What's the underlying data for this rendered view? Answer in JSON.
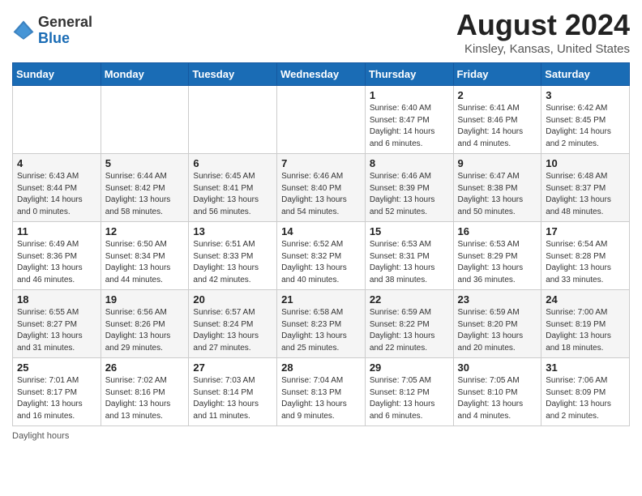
{
  "header": {
    "logo_general": "General",
    "logo_blue": "Blue",
    "main_title": "August 2024",
    "subtitle": "Kinsley, Kansas, United States"
  },
  "columns": [
    "Sunday",
    "Monday",
    "Tuesday",
    "Wednesday",
    "Thursday",
    "Friday",
    "Saturday"
  ],
  "footer": {
    "note": "Daylight hours"
  },
  "weeks": [
    [
      {
        "day": "",
        "info": ""
      },
      {
        "day": "",
        "info": ""
      },
      {
        "day": "",
        "info": ""
      },
      {
        "day": "",
        "info": ""
      },
      {
        "day": "1",
        "info": "Sunrise: 6:40 AM\nSunset: 8:47 PM\nDaylight: 14 hours\nand 6 minutes."
      },
      {
        "day": "2",
        "info": "Sunrise: 6:41 AM\nSunset: 8:46 PM\nDaylight: 14 hours\nand 4 minutes."
      },
      {
        "day": "3",
        "info": "Sunrise: 6:42 AM\nSunset: 8:45 PM\nDaylight: 14 hours\nand 2 minutes."
      }
    ],
    [
      {
        "day": "4",
        "info": "Sunrise: 6:43 AM\nSunset: 8:44 PM\nDaylight: 14 hours\nand 0 minutes."
      },
      {
        "day": "5",
        "info": "Sunrise: 6:44 AM\nSunset: 8:42 PM\nDaylight: 13 hours\nand 58 minutes."
      },
      {
        "day": "6",
        "info": "Sunrise: 6:45 AM\nSunset: 8:41 PM\nDaylight: 13 hours\nand 56 minutes."
      },
      {
        "day": "7",
        "info": "Sunrise: 6:46 AM\nSunset: 8:40 PM\nDaylight: 13 hours\nand 54 minutes."
      },
      {
        "day": "8",
        "info": "Sunrise: 6:46 AM\nSunset: 8:39 PM\nDaylight: 13 hours\nand 52 minutes."
      },
      {
        "day": "9",
        "info": "Sunrise: 6:47 AM\nSunset: 8:38 PM\nDaylight: 13 hours\nand 50 minutes."
      },
      {
        "day": "10",
        "info": "Sunrise: 6:48 AM\nSunset: 8:37 PM\nDaylight: 13 hours\nand 48 minutes."
      }
    ],
    [
      {
        "day": "11",
        "info": "Sunrise: 6:49 AM\nSunset: 8:36 PM\nDaylight: 13 hours\nand 46 minutes."
      },
      {
        "day": "12",
        "info": "Sunrise: 6:50 AM\nSunset: 8:34 PM\nDaylight: 13 hours\nand 44 minutes."
      },
      {
        "day": "13",
        "info": "Sunrise: 6:51 AM\nSunset: 8:33 PM\nDaylight: 13 hours\nand 42 minutes."
      },
      {
        "day": "14",
        "info": "Sunrise: 6:52 AM\nSunset: 8:32 PM\nDaylight: 13 hours\nand 40 minutes."
      },
      {
        "day": "15",
        "info": "Sunrise: 6:53 AM\nSunset: 8:31 PM\nDaylight: 13 hours\nand 38 minutes."
      },
      {
        "day": "16",
        "info": "Sunrise: 6:53 AM\nSunset: 8:29 PM\nDaylight: 13 hours\nand 36 minutes."
      },
      {
        "day": "17",
        "info": "Sunrise: 6:54 AM\nSunset: 8:28 PM\nDaylight: 13 hours\nand 33 minutes."
      }
    ],
    [
      {
        "day": "18",
        "info": "Sunrise: 6:55 AM\nSunset: 8:27 PM\nDaylight: 13 hours\nand 31 minutes."
      },
      {
        "day": "19",
        "info": "Sunrise: 6:56 AM\nSunset: 8:26 PM\nDaylight: 13 hours\nand 29 minutes."
      },
      {
        "day": "20",
        "info": "Sunrise: 6:57 AM\nSunset: 8:24 PM\nDaylight: 13 hours\nand 27 minutes."
      },
      {
        "day": "21",
        "info": "Sunrise: 6:58 AM\nSunset: 8:23 PM\nDaylight: 13 hours\nand 25 minutes."
      },
      {
        "day": "22",
        "info": "Sunrise: 6:59 AM\nSunset: 8:22 PM\nDaylight: 13 hours\nand 22 minutes."
      },
      {
        "day": "23",
        "info": "Sunrise: 6:59 AM\nSunset: 8:20 PM\nDaylight: 13 hours\nand 20 minutes."
      },
      {
        "day": "24",
        "info": "Sunrise: 7:00 AM\nSunset: 8:19 PM\nDaylight: 13 hours\nand 18 minutes."
      }
    ],
    [
      {
        "day": "25",
        "info": "Sunrise: 7:01 AM\nSunset: 8:17 PM\nDaylight: 13 hours\nand 16 minutes."
      },
      {
        "day": "26",
        "info": "Sunrise: 7:02 AM\nSunset: 8:16 PM\nDaylight: 13 hours\nand 13 minutes."
      },
      {
        "day": "27",
        "info": "Sunrise: 7:03 AM\nSunset: 8:14 PM\nDaylight: 13 hours\nand 11 minutes."
      },
      {
        "day": "28",
        "info": "Sunrise: 7:04 AM\nSunset: 8:13 PM\nDaylight: 13 hours\nand 9 minutes."
      },
      {
        "day": "29",
        "info": "Sunrise: 7:05 AM\nSunset: 8:12 PM\nDaylight: 13 hours\nand 6 minutes."
      },
      {
        "day": "30",
        "info": "Sunrise: 7:05 AM\nSunset: 8:10 PM\nDaylight: 13 hours\nand 4 minutes."
      },
      {
        "day": "31",
        "info": "Sunrise: 7:06 AM\nSunset: 8:09 PM\nDaylight: 13 hours\nand 2 minutes."
      }
    ]
  ]
}
